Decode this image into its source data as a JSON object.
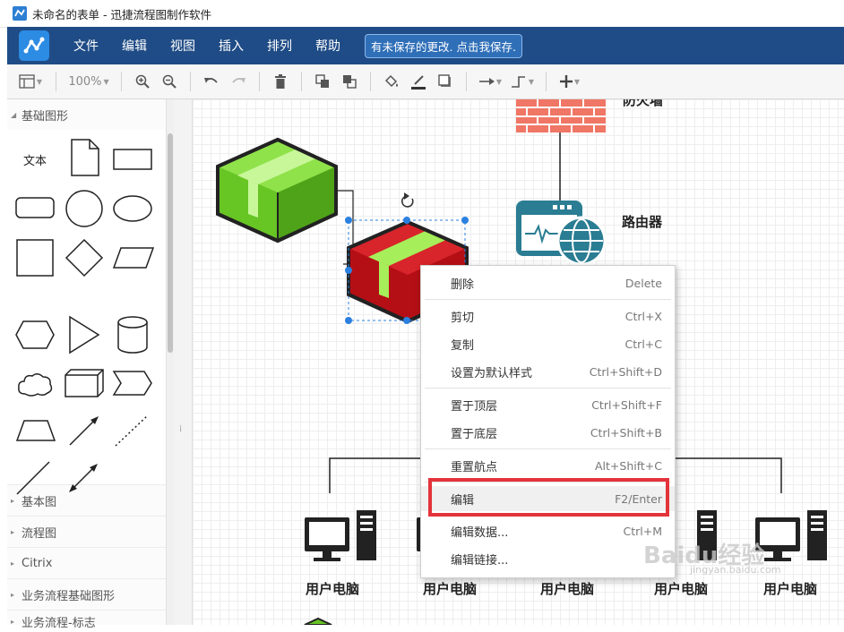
{
  "window": {
    "title": "未命名的表单 - 迅捷流程图制作软件"
  },
  "menubar": {
    "items": [
      "文件",
      "编辑",
      "视图",
      "插入",
      "排列",
      "帮助"
    ],
    "unsaved_notice": "有未保存的更改. 点击我保存."
  },
  "toolbar": {
    "zoom": "100%"
  },
  "sidebar": {
    "open_section": "基础图形",
    "text_shape_label": "文本",
    "collapsed_sections": [
      "基本图",
      "流程图",
      "Citrix",
      "业务流程基础图形",
      "业务流程-标志"
    ]
  },
  "canvas": {
    "labels": {
      "firewall": "防火墙",
      "router": "路由器",
      "pc": "用户电脑"
    }
  },
  "context_menu": {
    "items": [
      {
        "label": "删除",
        "shortcut": "Delete"
      },
      {
        "label": "剪切",
        "shortcut": "Ctrl+X"
      },
      {
        "label": "复制",
        "shortcut": "Ctrl+C"
      },
      {
        "label": "设置为默认样式",
        "shortcut": "Ctrl+Shift+D"
      },
      {
        "label": "置于顶层",
        "shortcut": "Ctrl+Shift+F"
      },
      {
        "label": "置于底层",
        "shortcut": "Ctrl+Shift+B"
      },
      {
        "label": "重置航点",
        "shortcut": "Alt+Shift+C"
      },
      {
        "label": "编辑",
        "shortcut": "F2/Enter"
      },
      {
        "label": "编辑数据...",
        "shortcut": "Ctrl+M"
      },
      {
        "label": "编辑链接...",
        "shortcut": ""
      }
    ]
  },
  "watermark": {
    "text": "Baidu经验",
    "url_text": "jingyan.baidu.com"
  },
  "colors": {
    "menubar": "#1f4c86",
    "highlight": "#e4333a",
    "green_box": "#7ed13b",
    "red_box": "#c0111a"
  }
}
